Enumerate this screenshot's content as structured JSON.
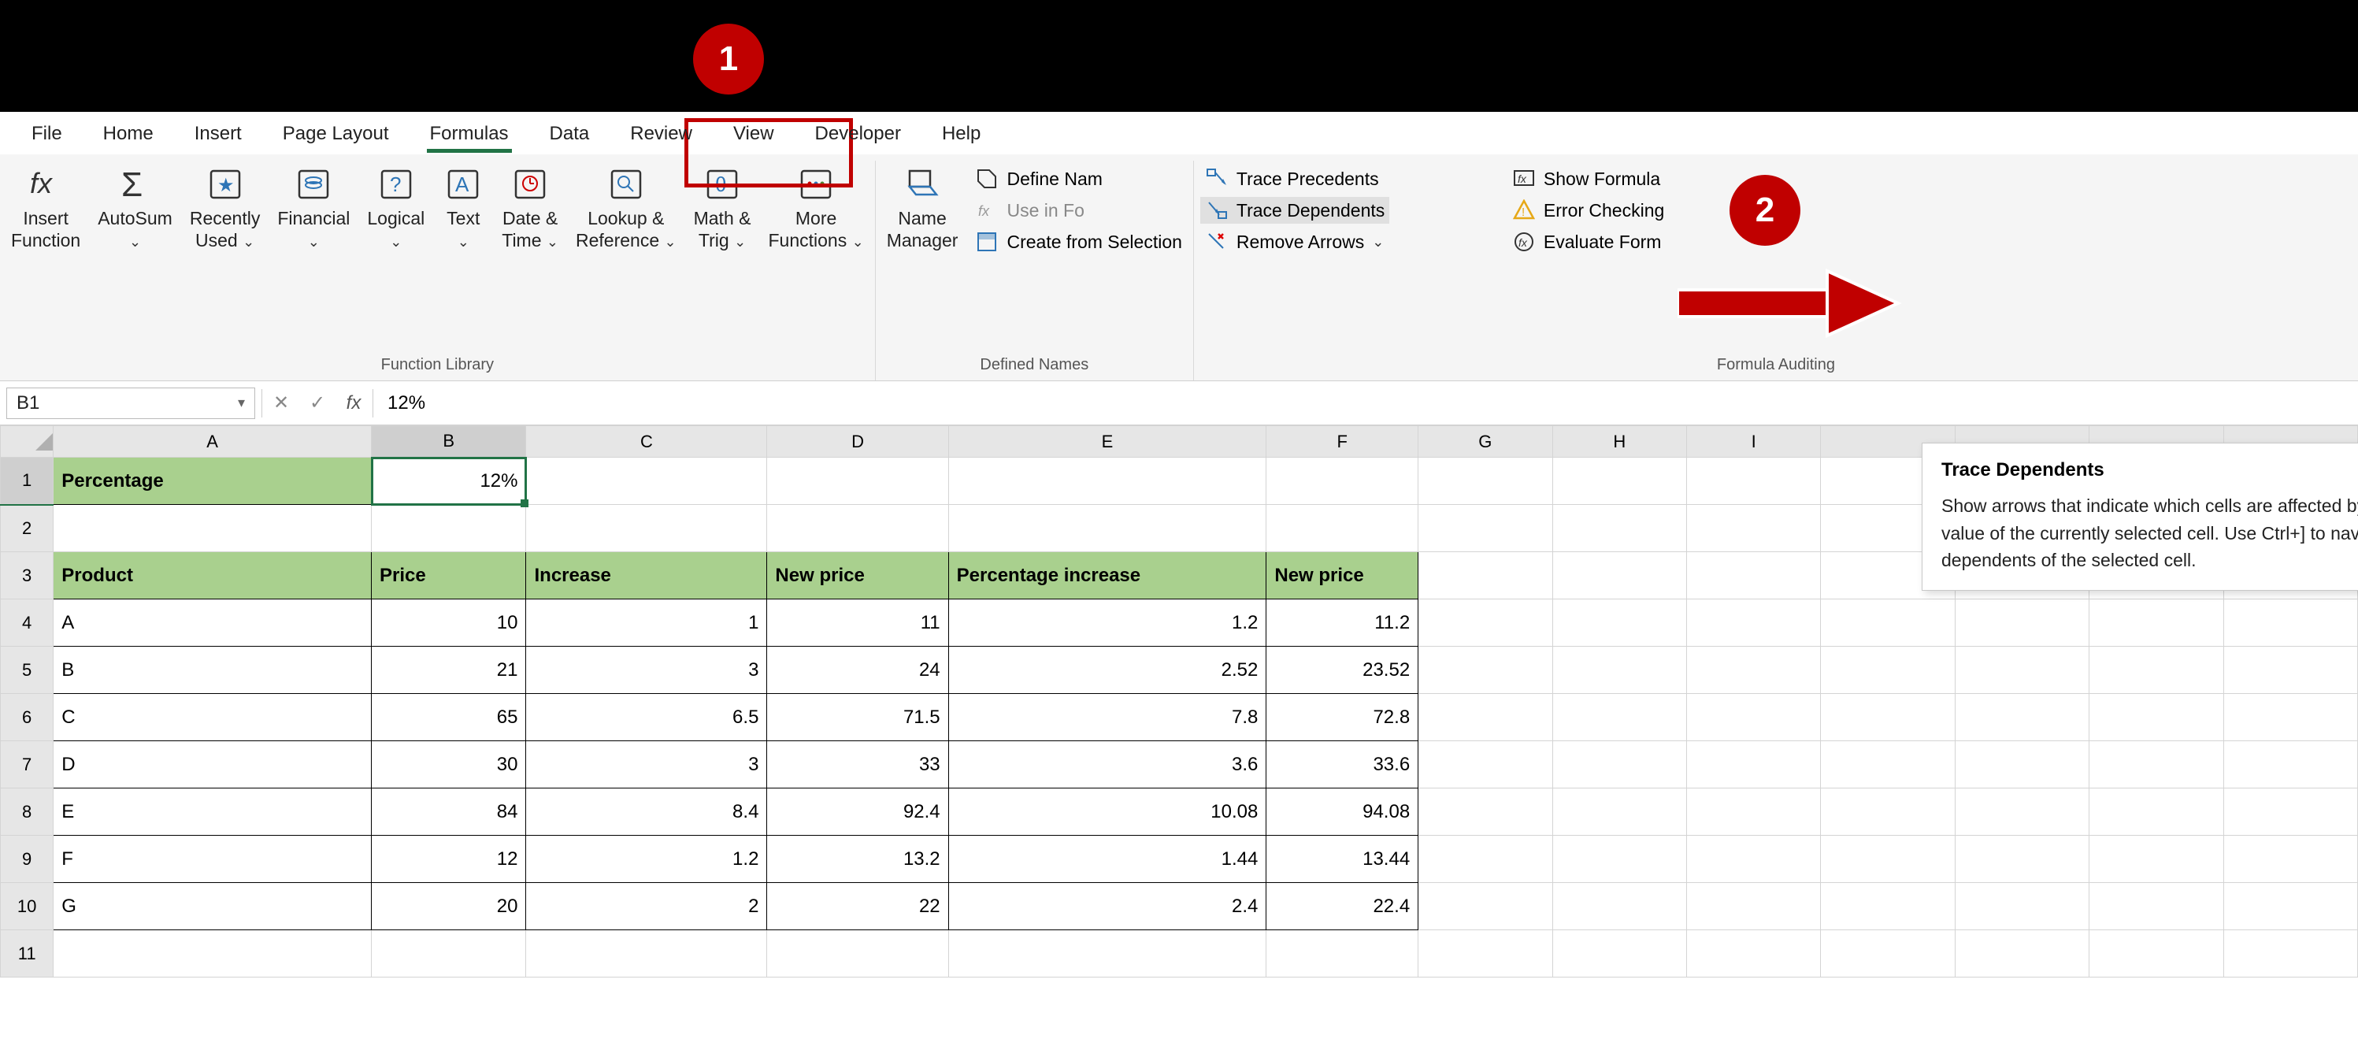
{
  "tabs": [
    "File",
    "Home",
    "Insert",
    "Page Layout",
    "Formulas",
    "Data",
    "Review",
    "View",
    "Developer",
    "Help"
  ],
  "ribbon": {
    "group_function_library": "Function Library",
    "insert_function": "Insert\nFunction",
    "autosum": "AutoSum",
    "recently_used": "Recently\nUsed",
    "financial": "Financial",
    "logical": "Logical",
    "text": "Text",
    "date_time": "Date &\nTime",
    "lookup_ref": "Lookup &\nReference",
    "math_trig": "Math &\nTrig",
    "more_functions": "More\nFunctions",
    "group_defined_names": "Defined Names",
    "name_manager": "Name\nManager",
    "define_name": "Define Nam",
    "use_in_formula": "Use in Fo",
    "create_from_selection": "Create from Selection",
    "group_formula_auditing": "Formula Auditing",
    "trace_precedents": "Trace Precedents",
    "trace_dependents": "Trace Dependents",
    "remove_arrows": "Remove Arrows",
    "show_formula": "Show Formula",
    "error_checking": "Error Checking",
    "evaluate_formula": "Evaluate Form"
  },
  "formula_bar": {
    "name_box": "B1",
    "value": "12%"
  },
  "columns": [
    "A",
    "B",
    "C",
    "D",
    "E",
    "F",
    "G",
    "H",
    "I"
  ],
  "rows_shown": 11,
  "sheet": {
    "A1": "Percentage",
    "B1": "12%",
    "A3": "Product",
    "B3": "Price",
    "C3": "Increase",
    "D3": "New price",
    "E3": "Percentage increase",
    "F3": "New price",
    "r4": {
      "A": "A",
      "B": "10",
      "C": "1",
      "D": "11",
      "E": "1.2",
      "F": "11.2"
    },
    "r5": {
      "A": "B",
      "B": "21",
      "C": "3",
      "D": "24",
      "E": "2.52",
      "F": "23.52"
    },
    "r6": {
      "A": "C",
      "B": "65",
      "C": "6.5",
      "D": "71.5",
      "E": "7.8",
      "F": "72.8"
    },
    "r7": {
      "A": "D",
      "B": "30",
      "C": "3",
      "D": "33",
      "E": "3.6",
      "F": "33.6"
    },
    "r8": {
      "A": "E",
      "B": "84",
      "C": "8.4",
      "D": "92.4",
      "E": "10.08",
      "F": "94.08"
    },
    "r9": {
      "A": "F",
      "B": "12",
      "C": "1.2",
      "D": "13.2",
      "E": "1.44",
      "F": "13.44"
    },
    "r10": {
      "A": "G",
      "B": "20",
      "C": "2",
      "D": "22",
      "E": "2.4",
      "F": "22.4"
    }
  },
  "tooltip": {
    "title": "Trace Dependents",
    "body": "Show arrows that indicate which cells are affected by the value of the currently selected cell. Use Ctrl+] to navigate to dependents of the selected cell."
  },
  "callouts": {
    "one": "1",
    "two": "2"
  }
}
